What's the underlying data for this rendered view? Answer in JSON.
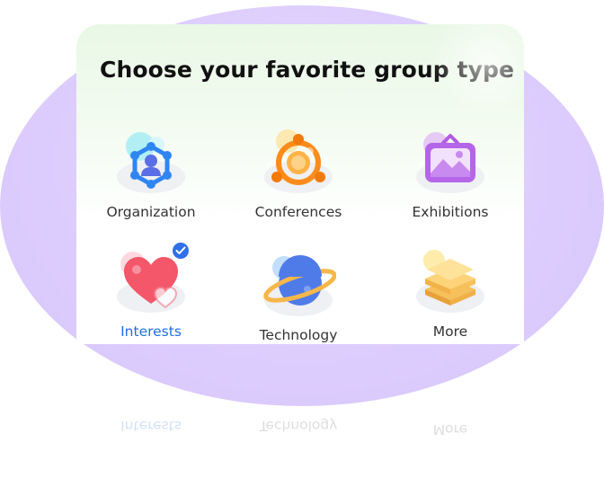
{
  "title": "Choose your favorite group type",
  "options": [
    {
      "label": "Organization",
      "icon": "organization-icon",
      "selected": false
    },
    {
      "label": "Conferences",
      "icon": "conferences-icon",
      "selected": false
    },
    {
      "label": "Exhibitions",
      "icon": "exhibitions-icon",
      "selected": false
    },
    {
      "label": "Interests",
      "icon": "interests-icon",
      "selected": true
    },
    {
      "label": "Technology",
      "icon": "technology-icon",
      "selected": false
    },
    {
      "label": "More",
      "icon": "more-icon",
      "selected": false
    }
  ],
  "colors": {
    "accent": "#1f6fe0",
    "checkmark": "#2f6fe8",
    "background_blob": "#ddcdfd",
    "title": "#111111",
    "label": "#333333"
  }
}
